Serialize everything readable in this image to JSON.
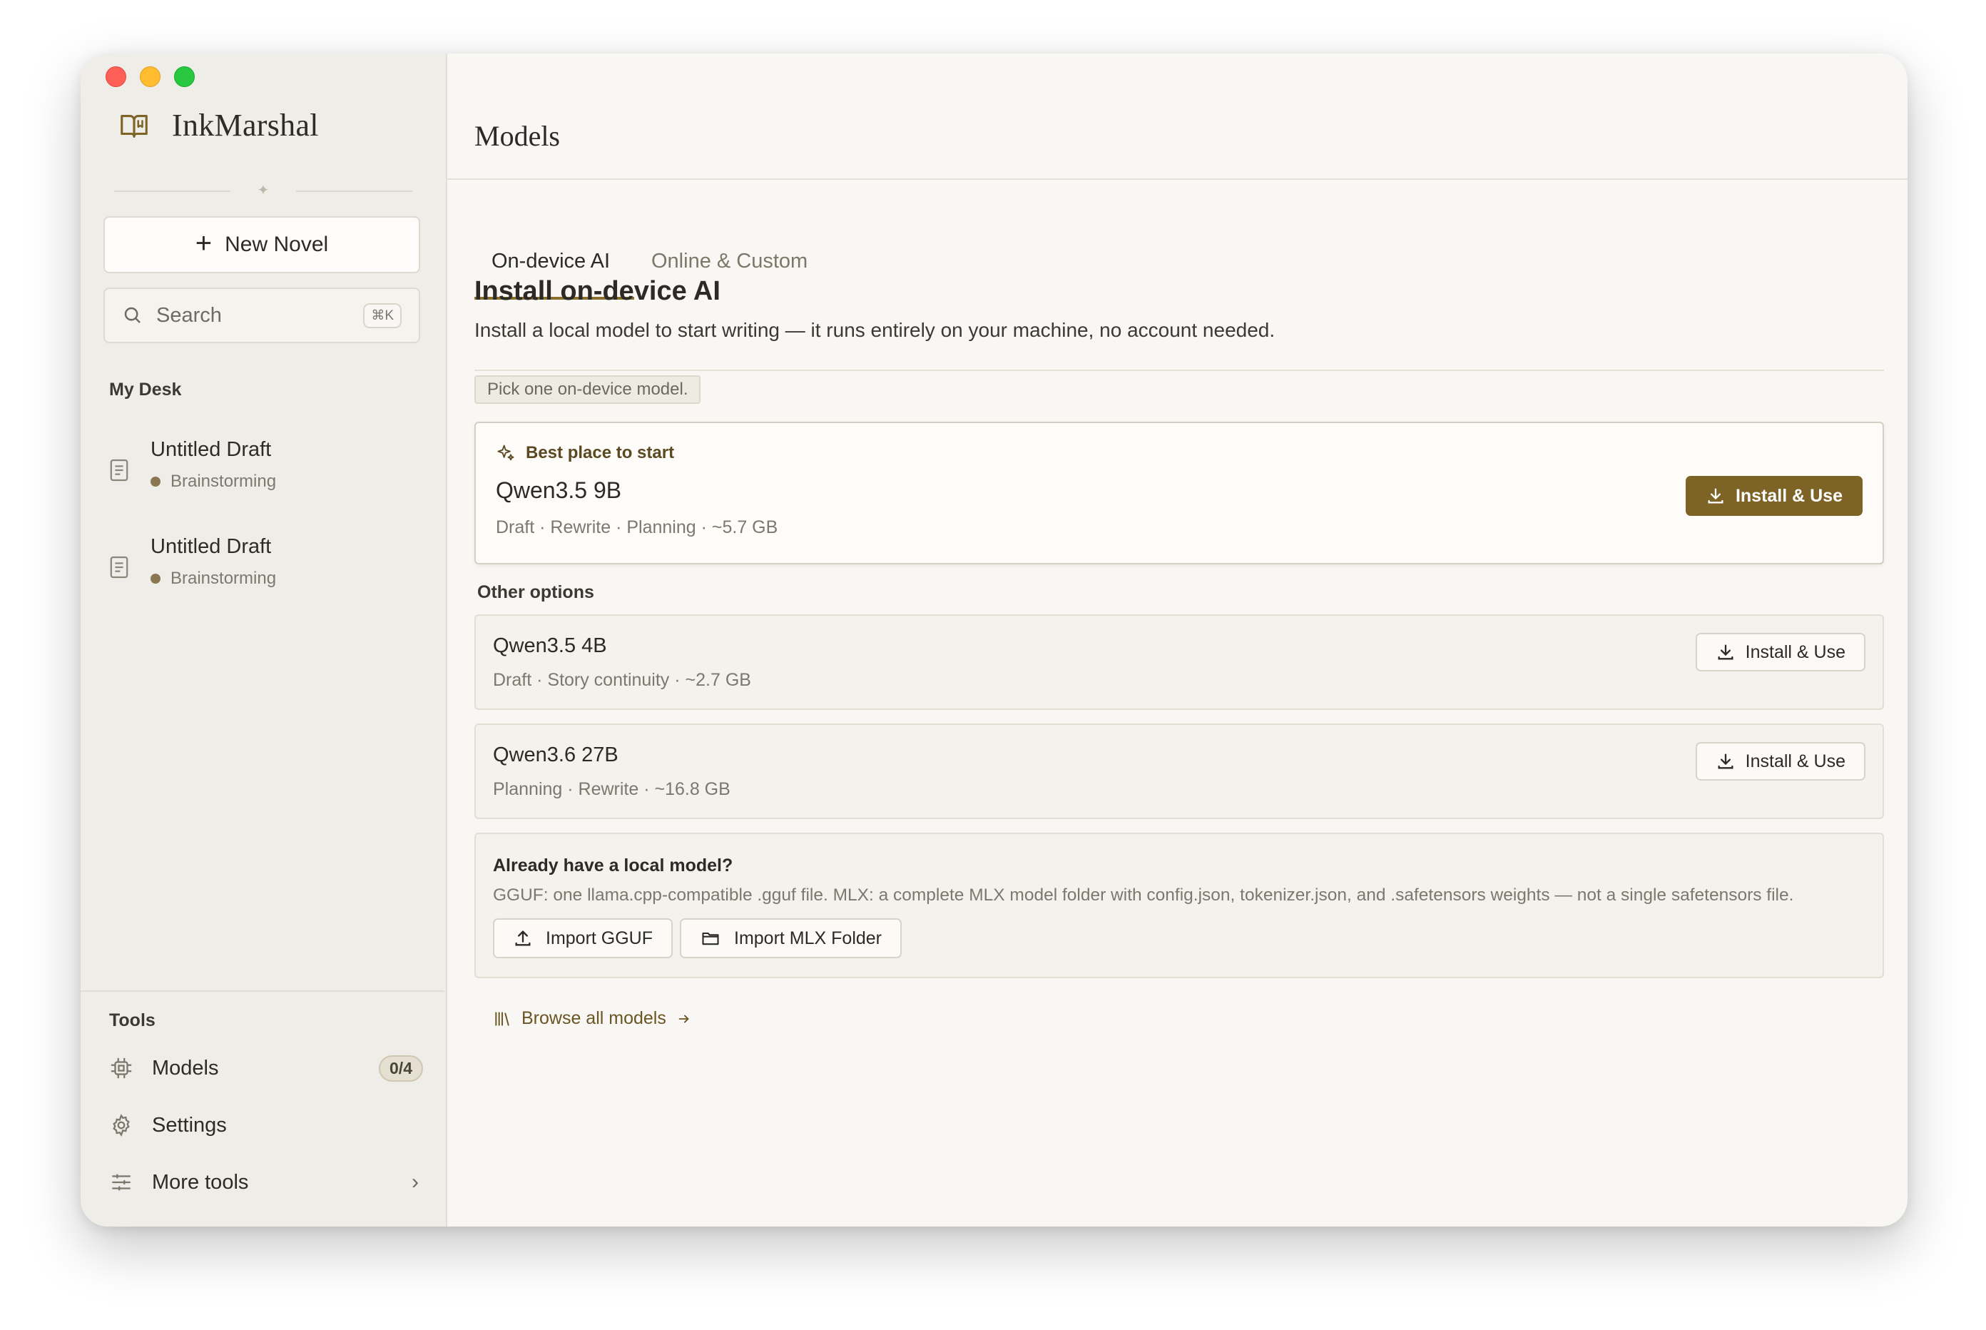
{
  "app": {
    "name": "InkMarshal"
  },
  "sidebar": {
    "new_novel_label": "New Novel",
    "search": {
      "label": "Search",
      "shortcut": "⌘K"
    },
    "my_desk_title": "My Desk",
    "drafts": [
      {
        "title": "Untitled Draft",
        "status": "Brainstorming"
      },
      {
        "title": "Untitled Draft",
        "status": "Brainstorming"
      }
    ],
    "tools_title": "Tools",
    "tools": [
      {
        "label": "Models",
        "badge": "0/4",
        "icon": "chip-icon"
      },
      {
        "label": "Settings",
        "icon": "gear-icon"
      },
      {
        "label": "More tools",
        "icon": "sliders-icon"
      }
    ]
  },
  "main": {
    "title": "Models",
    "tabs": [
      {
        "label": "On-device AI",
        "active": true
      },
      {
        "label": "Online & Custom",
        "active": false
      }
    ],
    "heading": "Install on-device AI",
    "subheading": "Install a local model to start writing — it runs entirely on your machine, no account needed.",
    "pick_hint": "Pick one on-device model.",
    "best": {
      "label": "Best place to start",
      "name": "Qwen3.5 9B",
      "meta": "Draft · Rewrite · Planning · ~5.7 GB",
      "button": "Install & Use"
    },
    "other_title": "Other options",
    "options": [
      {
        "name": "Qwen3.5 4B",
        "meta": "Draft · Story continuity · ~2.7 GB",
        "button": "Install & Use"
      },
      {
        "name": "Qwen3.6 27B",
        "meta": "Planning · Rewrite · ~16.8 GB",
        "button": "Install & Use"
      }
    ],
    "local": {
      "title": "Already have a local model?",
      "description": "GGUF: one llama.cpp-compatible .gguf file. MLX: a complete MLX model folder with config.json, tokenizer.json, and .safetensors weights — not a single safetensors file.",
      "import_gguf": "Import GGUF",
      "import_mlx": "Import MLX Folder"
    },
    "browse_label": "Browse all models"
  },
  "colors": {
    "accent": "#7d6325",
    "sidebar_bg": "#efede7",
    "main_bg": "#f8f7f3"
  }
}
